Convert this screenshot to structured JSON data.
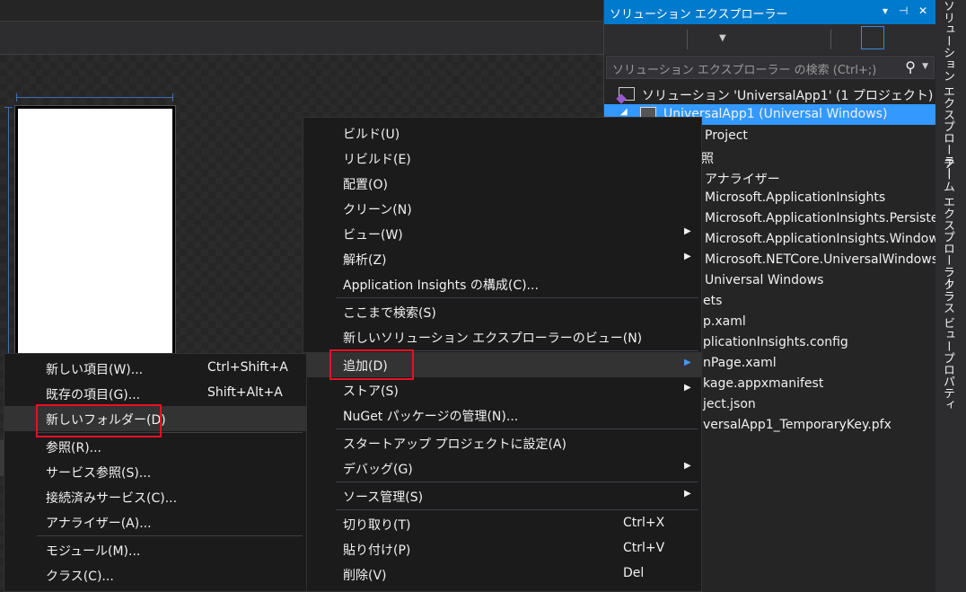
{
  "solution_explorer": {
    "title": "ソリューション エクスプローラー",
    "pin_label": "▾ ⊣ ✕",
    "search_placeholder": "ソリューション エクスプローラー の検索 (Ctrl+;)",
    "tree": [
      {
        "label": "ソリューション 'UniversalApp1' (1 プロジェクト)",
        "selected": false
      },
      {
        "label": "UniversalApp1 (Universal Windows)",
        "selected": true
      },
      {
        "label": "Project",
        "selected": false
      },
      {
        "label": "照",
        "selected": false
      },
      {
        "label": "アナライザー",
        "selected": false
      },
      {
        "label": "Microsoft.ApplicationInsights",
        "selected": false
      },
      {
        "label": "Microsoft.ApplicationInsights.Persistenc",
        "selected": false
      },
      {
        "label": "Microsoft.ApplicationInsights.Windows/",
        "selected": false
      },
      {
        "label": "Microsoft.NETCore.UniversalWindowsPl",
        "selected": false
      },
      {
        "label": "Universal Windows",
        "selected": false
      },
      {
        "label": "ets",
        "selected": false
      },
      {
        "label": "p.xaml",
        "selected": false
      },
      {
        "label": "plicationInsights.config",
        "selected": false
      },
      {
        "label": "nPage.xaml",
        "selected": false
      },
      {
        "label": "kage.appxmanifest",
        "selected": false
      },
      {
        "label": "ject.json",
        "selected": false
      },
      {
        "label": "versalApp1_TemporaryKey.pfx",
        "selected": false
      }
    ]
  },
  "side_tabs": [
    "ソリューション エクスプローラー",
    "チーム エクスプローラー",
    "クラス ビュー",
    "プロパティ"
  ],
  "project_menu": {
    "items": [
      {
        "label": "ビルド(U)"
      },
      {
        "label": "リビルド(E)"
      },
      {
        "label": "配置(O)"
      },
      {
        "label": "クリーン(N)"
      },
      {
        "label": "ビュー(W)",
        "submenu": true
      },
      {
        "label": "解析(Z)",
        "submenu": true
      },
      {
        "label": "Application Insights の構成(C)..."
      },
      {
        "label": "ここまで検索(S)"
      },
      {
        "label": "新しいソリューション エクスプローラーのビュー(N)"
      },
      {
        "label": "追加(D)",
        "submenu": true
      },
      {
        "label": "ストア(S)",
        "submenu": true
      },
      {
        "label": "NuGet パッケージの管理(N)..."
      },
      {
        "label": "スタートアップ プロジェクトに設定(A)"
      },
      {
        "label": "デバッグ(G)",
        "submenu": true
      },
      {
        "label": "ソース管理(S)",
        "submenu": true
      },
      {
        "label": "切り取り(T)",
        "shortcut": "Ctrl+X"
      },
      {
        "label": "貼り付け(P)",
        "shortcut": "Ctrl+V"
      },
      {
        "label": "削除(V)",
        "shortcut": "Del"
      }
    ]
  },
  "add_menu": {
    "items": [
      {
        "label": "新しい項目(W)...",
        "shortcut": "Ctrl+Shift+A"
      },
      {
        "label": "既存の項目(G)...",
        "shortcut": "Shift+Alt+A"
      },
      {
        "label": "新しいフォルダー(D)"
      },
      {
        "label": "参照(R)..."
      },
      {
        "label": "サービス参照(S)..."
      },
      {
        "label": "接続済みサービス(C)..."
      },
      {
        "label": "アナライザー(A)..."
      },
      {
        "label": "モジュール(M)..."
      },
      {
        "label": "クラス(C)..."
      }
    ]
  },
  "colors": {
    "accent": "#007acc",
    "selection": "#3399ff",
    "highlight_box": "#e81123"
  }
}
